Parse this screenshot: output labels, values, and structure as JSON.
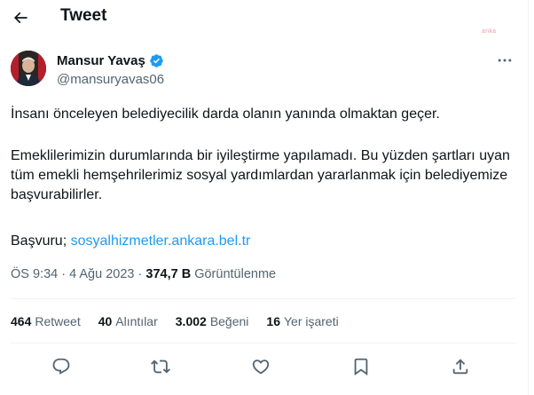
{
  "header": {
    "title": "Tweet",
    "back_icon": "arrow-left-icon",
    "watermark": "anka"
  },
  "author": {
    "name": "Mansur Yavaş",
    "handle": "@mansuryavas06",
    "verified_icon": "verified-badge-icon",
    "verified_color": "#1d9bf0",
    "more_icon": "more-horizontal-icon"
  },
  "tweet": {
    "paragraph1": "İnsanı önceleyen belediyecilik darda olanın yanında olmaktan geçer.",
    "paragraph2": "Emeklilerimizin durumlarında bir iyileştirme yapılamadı. Bu yüzden şartları uyan tüm emekli hemşehrilerimiz sosyal yardımlardan yararlanmak için belediyemize başvurabilirler.",
    "apply_label": "Başvuru; ",
    "link_text": "sosyalhizmetler.ankara.bel.tr",
    "link_color": "#1d9bf0"
  },
  "meta": {
    "time": "ÖS 9:34",
    "separator": " · ",
    "date": "4 Ağu 2023",
    "views_count": "374,7 B",
    "views_label": "Görüntülenme"
  },
  "stats": [
    {
      "value": "464",
      "label": "Retweet"
    },
    {
      "value": "40",
      "label": "Alıntılar"
    },
    {
      "value": "3.002",
      "label": "Beğeni"
    },
    {
      "value": "16",
      "label": "Yer işareti"
    }
  ],
  "actions": [
    {
      "icon": "reply-icon"
    },
    {
      "icon": "retweet-icon"
    },
    {
      "icon": "like-heart-icon"
    },
    {
      "icon": "bookmark-icon"
    },
    {
      "icon": "share-icon"
    }
  ],
  "colors": {
    "text": "#0f1419",
    "secondary": "#536471",
    "divider": "#eff3f4"
  }
}
